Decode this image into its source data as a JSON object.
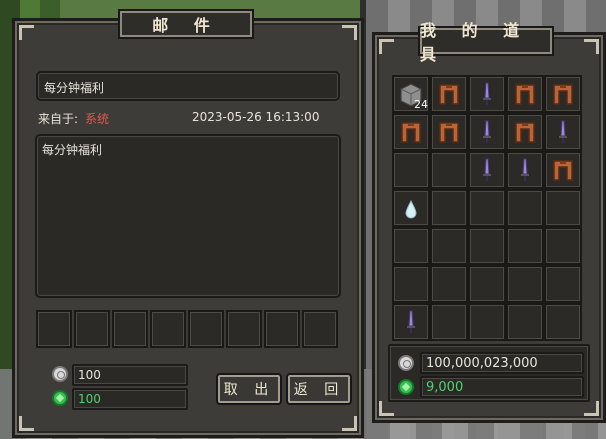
{
  "mail_window": {
    "title": "邮 件",
    "subject": "每分钟福利",
    "from_label": "来自于:",
    "from_value": "系统",
    "timestamp": "2023-05-26 16:13:00",
    "body": "每分钟福利",
    "attachment_slots": 8,
    "silver_amount": "100",
    "gem_amount": "100",
    "take_button": "取 出",
    "back_button": "返 回",
    "colors": {
      "from_value": "#e05a4a",
      "gem_amount": "#4fd36a"
    }
  },
  "inventory_window": {
    "title": "我 的 道 具",
    "grid": {
      "columns": 5,
      "rows": 7,
      "items": [
        [
          "stone-block-item",
          "chestplate-item",
          "sword-item",
          "chestplate-item",
          "chestplate-item"
        ],
        [
          "chestplate-item",
          "chestplate-item",
          "sword-item",
          "chestplate-item",
          "sword-item"
        ],
        [
          "",
          "",
          "sword-item",
          "sword-item",
          "chestplate-item"
        ],
        [
          "water-drop-item",
          "",
          "",
          "",
          ""
        ],
        [
          "",
          "",
          "",
          "",
          ""
        ],
        [
          "",
          "",
          "",
          "",
          ""
        ],
        [
          "sword-item",
          "",
          "",
          "",
          ""
        ]
      ],
      "stack_counts": {
        "0-0": "24"
      }
    },
    "silver_amount": "100,000,023,000",
    "gem_amount": "9,000"
  }
}
